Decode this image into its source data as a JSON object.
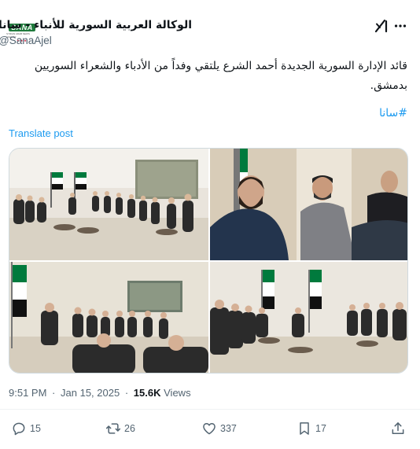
{
  "author": {
    "name": "الوكالة العربية السورية للأنباء - سانا",
    "handle": "@SanaAjel",
    "avatar_logo": "SANA",
    "avatar_sub": "SYRIAN ARAB NEWS AGENCY"
  },
  "header_icons": {
    "grok": "grok-icon",
    "more": "more-icon"
  },
  "post": {
    "text": "قائد الإدارة السورية الجديدة أحمد الشرع يلتقي وفداً من الأدباء والشعراء السوريين بدمشق.",
    "hashtag": "#سانا",
    "translate_label": "Translate post"
  },
  "media": {
    "photo_count": 4
  },
  "meta": {
    "time": "9:51 PM",
    "date": "Jan 15, 2025",
    "views": "15.6K",
    "views_label": "Views"
  },
  "actions": {
    "replies": "15",
    "reposts": "26",
    "likes": "337",
    "bookmarks": "17"
  },
  "colors": {
    "accent": "#1d9bf0",
    "muted": "#536471",
    "text": "#0f1419",
    "flag_green": "#007a3d",
    "flag_red": "#ce1126"
  }
}
